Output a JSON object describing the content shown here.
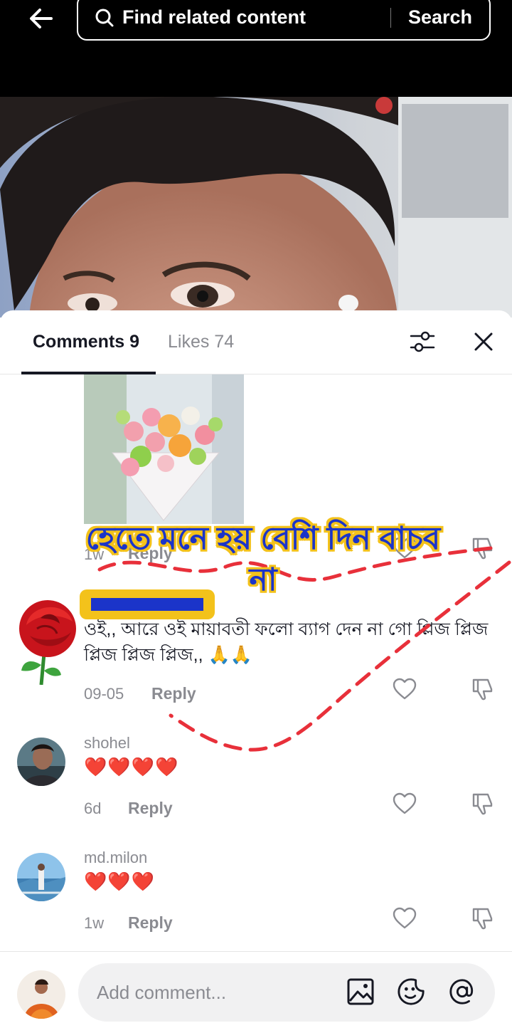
{
  "header": {
    "search_placeholder": "Find related content",
    "search_button": "Search"
  },
  "tabs": {
    "comments": "Comments 9",
    "likes": "Likes 74"
  },
  "overlay_caption": {
    "line1": "হেতে মনে হয় বেশি দিন বাচব",
    "line2": "না"
  },
  "sticker_comment": {
    "time": "1w",
    "reply": "Reply"
  },
  "comments": [
    {
      "username": "",
      "text": "ওই,, আরে ওই মায়াবতী ফলো ব্যাগ দেন না গো প্লিজ প্লিজ প্লিজ প্লিজ প্লিজ,, 🙏🙏",
      "time": "09-05",
      "reply": "Reply",
      "avatar": "rose"
    },
    {
      "username": "shohel",
      "text": "❤️❤️❤️❤️",
      "time": "6d",
      "reply": "Reply",
      "avatar": "man"
    },
    {
      "username": "md.milon",
      "text": "❤️❤️❤️",
      "time": "1w",
      "reply": "Reply",
      "avatar": "beach"
    }
  ],
  "composer": {
    "placeholder": "Add comment..."
  },
  "icons": [
    "back-arrow-icon",
    "search-icon",
    "filter-icon",
    "close-icon",
    "heart-icon",
    "dislike-icon",
    "image-icon",
    "emoji-icon",
    "mention-icon"
  ],
  "colors": {
    "accent_red": "#e8202c",
    "caption_blue": "#1b34c9",
    "caption_yellow": "#f3c21b"
  }
}
